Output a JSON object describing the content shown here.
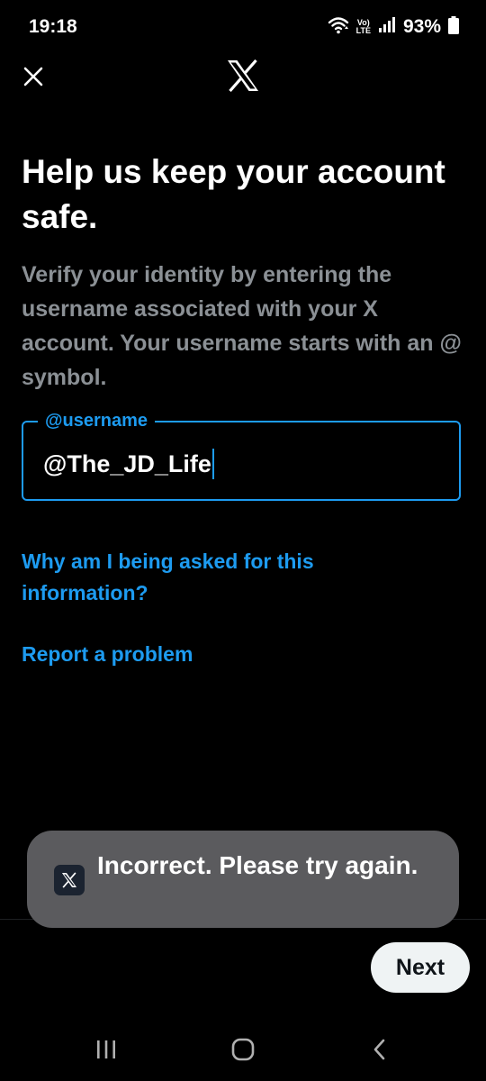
{
  "status_bar": {
    "time": "19:18",
    "volte_line1": "Vo)",
    "volte_line2": "LTE",
    "battery": "93%",
    "icons": [
      "wifi-icon",
      "volte-icon",
      "signal-icon",
      "battery-icon"
    ]
  },
  "header": {
    "close_icon": "close-icon",
    "logo": "x-logo"
  },
  "main": {
    "title": "Help us keep your account safe.",
    "description": "Verify your identity by entering the username associated with your X account. Your username starts with an @ symbol.",
    "field": {
      "label": "@username",
      "value": "@The_JD_Life"
    },
    "why_link": "Why am I being asked for this information?",
    "report_link": "Report a problem"
  },
  "toast": {
    "icon": "x-app-icon",
    "message": "Incorrect. Please try again."
  },
  "footer": {
    "next_label": "Next"
  },
  "nav_bar": {
    "icons": [
      "recent-apps-icon",
      "home-icon",
      "back-icon"
    ]
  },
  "colors": {
    "accent": "#1d9bf0",
    "background": "#000000",
    "secondary_text": "#8b9095",
    "toast_bg": "#5b5b5e"
  }
}
